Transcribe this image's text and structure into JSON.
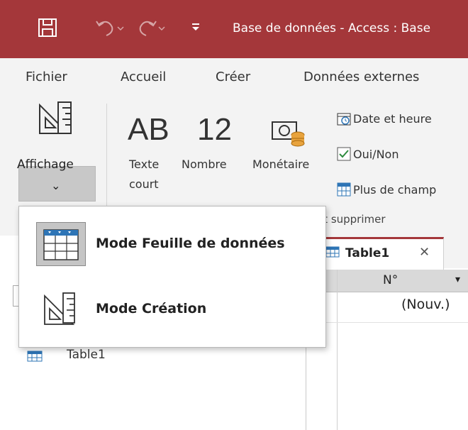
{
  "window": {
    "title": "Base de données - Access : Base"
  },
  "ribbon": {
    "tabs": [
      "Fichier",
      "Accueil",
      "Créer",
      "Données externes"
    ],
    "view_button": {
      "label": "Affichage",
      "arrow": "⌄"
    },
    "fields": [
      {
        "icon": "AB",
        "label_line1": "Texte",
        "label_line2": "court"
      },
      {
        "icon": "12",
        "label_line1": "Nombre",
        "label_line2": ""
      },
      {
        "icon": "currency-icon",
        "label_line1": "Monétaire",
        "label_line2": ""
      }
    ],
    "small_buttons": [
      "Date et heure",
      "Oui/Non",
      "Plus de champ"
    ],
    "group_label": "r et supprimer"
  },
  "dropdown": {
    "items": [
      {
        "label": "Mode Feuille de données",
        "icon": "datasheet-view-icon",
        "active": true
      },
      {
        "label": "Mode Création",
        "icon": "design-view-icon",
        "active": false
      }
    ]
  },
  "navigation": {
    "items": [
      {
        "label": "Table1",
        "icon": "table-icon"
      }
    ]
  },
  "document": {
    "tab_label": "Table1",
    "close_glyph": "✕",
    "column_header": "N°",
    "new_row_value": "(Nouv.)",
    "new_row_marker": "*"
  },
  "colors": {
    "titlebar": "#a4373a",
    "ribbon_bg": "#f3f3f3",
    "accent_blue": "#2e75b6",
    "check_green": "#2e8b3e"
  }
}
